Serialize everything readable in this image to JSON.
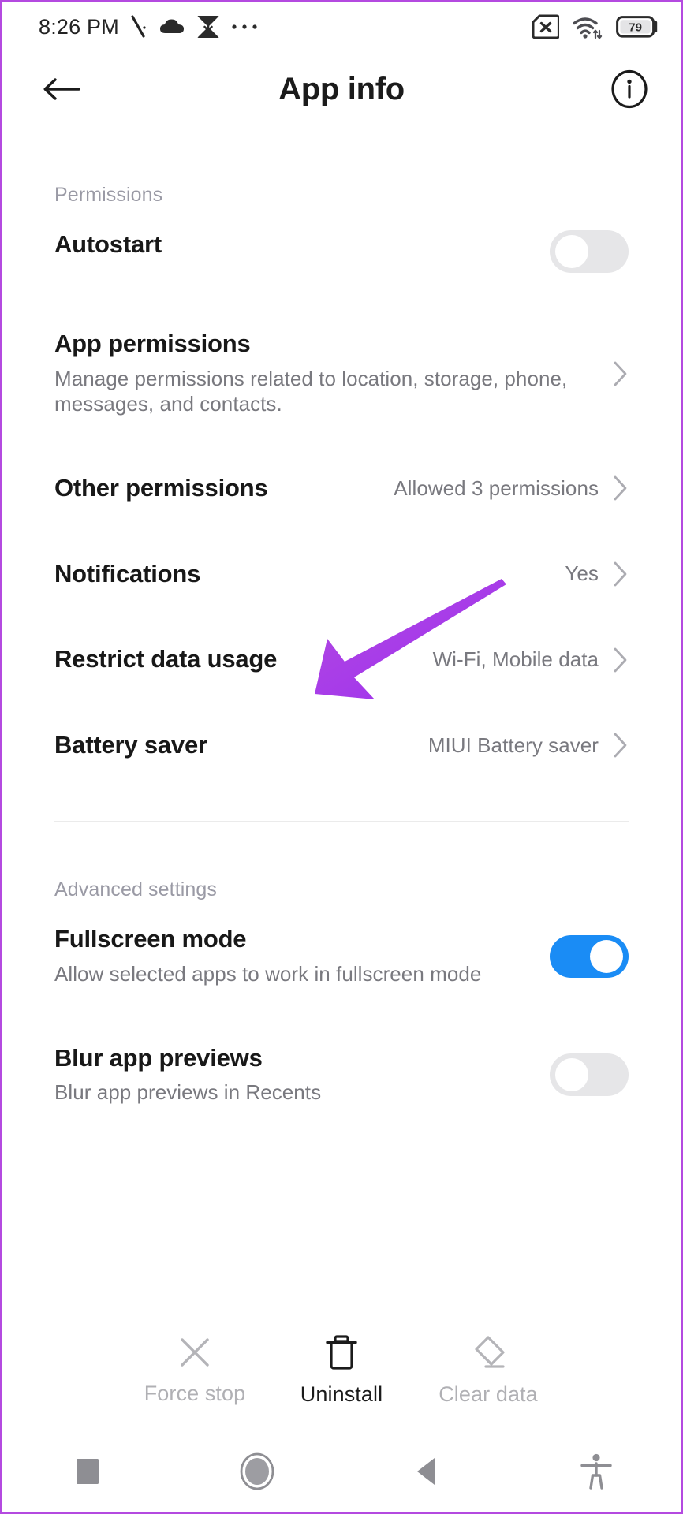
{
  "status_bar": {
    "time": "8:26 PM",
    "left_icons": [
      "silent-mode-icon",
      "cloud-icon",
      "download-icon",
      "more-notifications-icon"
    ],
    "right_icons": [
      "sim-card-missing-icon",
      "wifi-icon",
      "battery-icon"
    ],
    "battery_level": "79"
  },
  "app_bar": {
    "title": "App info",
    "back_icon": "back-arrow-icon",
    "info_icon": "info-circle-icon"
  },
  "sections": [
    {
      "label": "Permissions",
      "rows": [
        {
          "title": "Autostart",
          "desc": "",
          "value": "",
          "control": "toggle",
          "toggle_on": false
        },
        {
          "title": "App permissions",
          "desc": "Manage permissions related to location, storage, phone, messages, and contacts.",
          "value": "",
          "control": "chevron"
        },
        {
          "title": "Other permissions",
          "desc": "",
          "value": "Allowed 3 permissions",
          "control": "chevron"
        },
        {
          "title": "Notifications",
          "desc": "",
          "value": "Yes",
          "control": "chevron"
        },
        {
          "title": "Restrict data usage",
          "desc": "",
          "value": "Wi-Fi, Mobile data",
          "control": "chevron"
        },
        {
          "title": "Battery saver",
          "desc": "",
          "value": "MIUI Battery saver",
          "control": "chevron"
        }
      ]
    },
    {
      "label": "Advanced settings",
      "rows": [
        {
          "title": "Fullscreen mode",
          "desc": "Allow selected apps to work in fullscreen mode",
          "value": "",
          "control": "toggle",
          "toggle_on": true
        },
        {
          "title": "Blur app previews",
          "desc": "Blur app previews in Recents",
          "value": "",
          "control": "toggle",
          "toggle_on": false
        }
      ]
    }
  ],
  "bottom_actions": [
    {
      "label": "Force stop",
      "icon": "close-x-icon",
      "enabled": false
    },
    {
      "label": "Uninstall",
      "icon": "trash-icon",
      "enabled": true
    },
    {
      "label": "Clear data",
      "icon": "eraser-icon",
      "enabled": false
    }
  ],
  "nav_bar": {
    "buttons": [
      "recents-square-icon",
      "home-circle-icon",
      "back-triangle-icon",
      "accessibility-icon"
    ]
  },
  "annotation": {
    "type": "arrow",
    "color": "#a93df0",
    "points_to": "Restrict data usage"
  },
  "colors": {
    "accent_toggle_on": "#1a8cf5",
    "toggle_off": "#e6e6e8",
    "annotation_purple": "#a93df0",
    "frame_purple": "#b44ae0",
    "title_text": "#181818",
    "secondary_text": "#79797f",
    "section_label": "#9a9aa5"
  }
}
